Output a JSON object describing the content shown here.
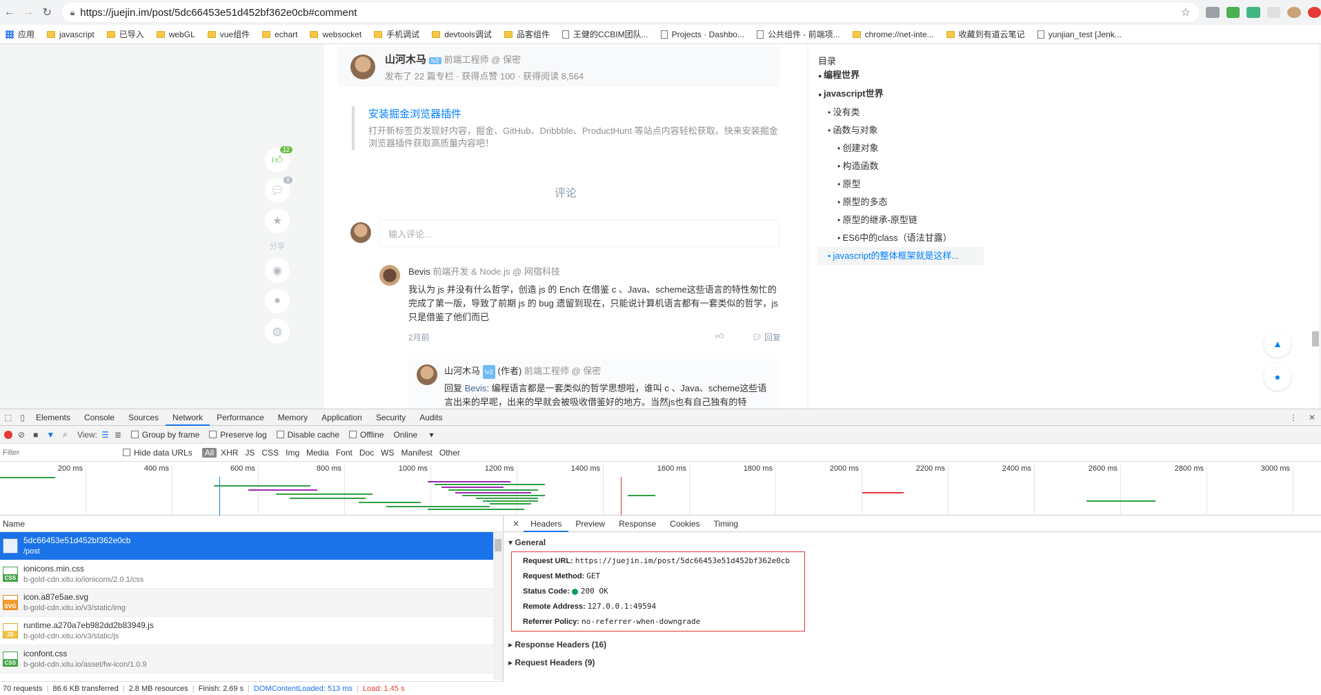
{
  "browser": {
    "url": "https://juejin.im/post/5dc66453e51d452bf362e0cb#comment",
    "bookmarks": [
      "应用",
      "javascript",
      "已导入",
      "webGL",
      "vue组件",
      "echart",
      "websocket",
      "手机调试",
      "devtools调试",
      "品客组件",
      "王健的CCBIM团队...",
      "Projects · Dashbo...",
      "公共组件 - 前端项...",
      "chrome://net-inte...",
      "收藏到有道云笔记",
      "yunjian_test [Jenk..."
    ]
  },
  "article": {
    "author_name": "山河木马",
    "author_level": "lv2",
    "author_title": "前端工程师 @ 保密",
    "author_stats": "发布了 22 篇专栏 · 获得点赞 100 · 获得阅读 8,564",
    "plugin_title": "安装掘金浏览器插件",
    "plugin_desc": "打开新标签页发现好内容，掘金、GitHub、Dribbble、ProductHunt 等站点内容轻松获取。快来安装掘金浏览器插件获取高质量内容吧！",
    "comments_heading": "评论",
    "comment_placeholder": "输入评论...",
    "like_count": "12",
    "comment_count": "8",
    "share_label": "分享",
    "comment1": {
      "user": "Bevis",
      "title": "前端开发 & Node.js @ 网宿科技",
      "text": "我认为 js 并没有什么哲学，创造 js 的 Ench 在借鉴 c 、Java、scheme这些语言的特性匆忙的完成了第一版，导致了前期 js 的 bug 遗留到现在，只能说计算机语言都有一套类似的哲学，js 只是借鉴了他们而已",
      "time": "2月前",
      "reply_label": "回复"
    },
    "reply1": {
      "user": "山河木马",
      "level": "lv2",
      "author_tag": "(作者)",
      "title": "前端工程师 @ 保密",
      "prefix": "回复",
      "to": "Bevis",
      "text": ": 编程语言都是一套类似的哲学思想啦，谁叫 c 、Java、scheme这些语言出来的早呢，出来的早就会被吸收借鉴好的地方。当然js也有自己独有的特"
    }
  },
  "toc": {
    "title": "目录",
    "items": [
      {
        "text": "编程世界",
        "level": 1
      },
      {
        "text": "javascript世界",
        "level": 1
      },
      {
        "text": "没有类",
        "level": 2
      },
      {
        "text": "函数与对象",
        "level": 2
      },
      {
        "text": "创建对象",
        "level": 3
      },
      {
        "text": "构造函数",
        "level": 3
      },
      {
        "text": "原型",
        "level": 3
      },
      {
        "text": "原型的多态",
        "level": 3
      },
      {
        "text": "原型的继承-原型链",
        "level": 3
      },
      {
        "text": "ES6中的class（语法甘露）",
        "level": 3
      },
      {
        "text": "javascript的整体框架就是这样...",
        "level": 2,
        "active": true
      }
    ]
  },
  "devtools": {
    "tabs": [
      "Elements",
      "Console",
      "Sources",
      "Network",
      "Performance",
      "Memory",
      "Application",
      "Security",
      "Audits"
    ],
    "active_tab": "Network",
    "toolbar": {
      "view_label": "View:",
      "group_by_frame": "Group by frame",
      "preserve_log": "Preserve log",
      "disable_cache": "Disable cache",
      "offline": "Offline",
      "throttle": "Online"
    },
    "filter": {
      "placeholder": "Filter",
      "hide_data_urls": "Hide data URLs",
      "types": [
        "All",
        "XHR",
        "JS",
        "CSS",
        "Img",
        "Media",
        "Font",
        "Doc",
        "WS",
        "Manifest",
        "Other"
      ]
    },
    "timeline_ticks": [
      "200 ms",
      "400 ms",
      "600 ms",
      "800 ms",
      "1000 ms",
      "1200 ms",
      "1400 ms",
      "1600 ms",
      "1800 ms",
      "2000 ms",
      "2200 ms",
      "2400 ms",
      "2600 ms",
      "2800 ms",
      "3000 ms"
    ],
    "name_header": "Name",
    "requests": [
      {
        "name": "5dc66453e51d452bf362e0cb",
        "sub": "/post",
        "type": "doc",
        "selected": true
      },
      {
        "name": "ionicons.min.css",
        "sub": "b-gold-cdn.xitu.io/ionicons/2.0.1/css",
        "type": "css"
      },
      {
        "name": "icon.a87e5ae.svg",
        "sub": "b-gold-cdn.xitu.io/v3/static/img",
        "type": "svg"
      },
      {
        "name": "runtime.a270a7eb982dd2b83949.js",
        "sub": "b-gold-cdn.xitu.io/v3/static/js",
        "type": "js"
      },
      {
        "name": "iconfont.css",
        "sub": "b-gold-cdn.xitu.io/asset/fw-icon/1.0.9",
        "type": "css"
      }
    ],
    "status_bar": {
      "requests": "70 requests",
      "transferred": "86.6 KB transferred",
      "resources": "2.8 MB resources",
      "finish": "Finish: 2.69 s",
      "dcl": "DOMContentLoaded: 513 ms",
      "load": "Load: 1.45 s"
    },
    "detail_tabs": [
      "Headers",
      "Preview",
      "Response",
      "Cookies",
      "Timing"
    ],
    "general_label": "General",
    "general": [
      {
        "k": "Request URL:",
        "v": "https://juejin.im/post/5dc66453e51d452bf362e0cb"
      },
      {
        "k": "Request Method:",
        "v": "GET"
      },
      {
        "k": "Status Code:",
        "v": "200 OK",
        "dot": true
      },
      {
        "k": "Remote Address:",
        "v": "127.0.0.1:49594"
      },
      {
        "k": "Referrer Policy:",
        "v": "no-referrer-when-downgrade"
      }
    ],
    "response_headers": "Response Headers (16)",
    "request_headers": "Request Headers (9)",
    "colors": {
      "accent": "#1a73e8",
      "highlight": "#e53935",
      "status_ok": "#0d9d58"
    }
  }
}
